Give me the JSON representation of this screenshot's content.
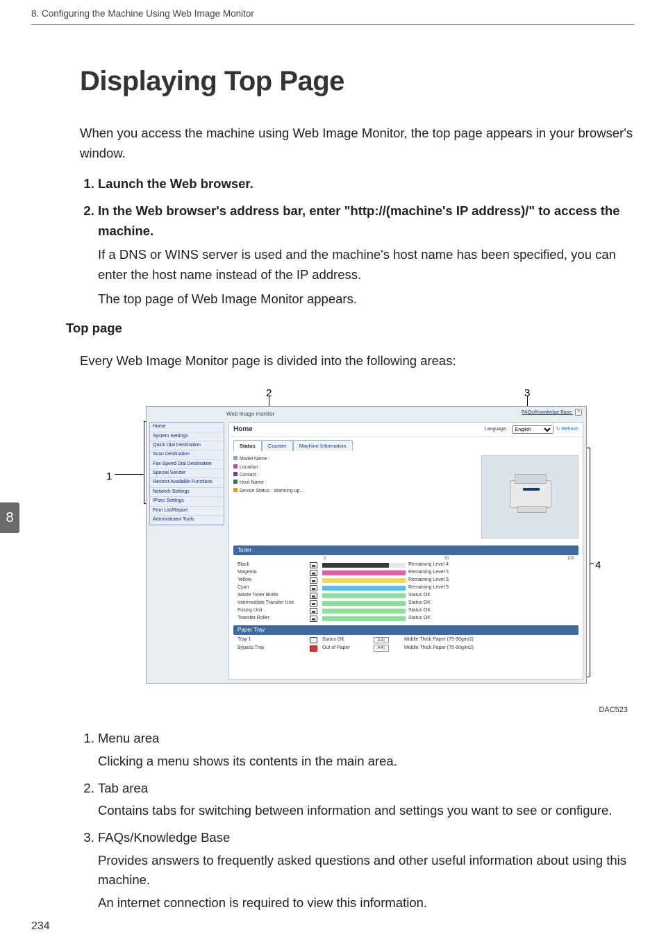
{
  "running_head": "8. Configuring the Machine Using Web Image Monitor",
  "chapter_tab": "8",
  "page_number": "234",
  "title": "Displaying Top Page",
  "intro": "When you access the machine using Web Image Monitor, the top page appears in your browser's window.",
  "steps": [
    {
      "head": "Launch the Web browser.",
      "body": []
    },
    {
      "head": "In the Web browser's address bar, enter \"http://(machine's IP address)/\" to access the machine.",
      "body": [
        "If a DNS or WINS server is used and the machine's host name has been specified, you can enter the host name instead of the IP address.",
        "The top page of Web Image Monitor appears."
      ]
    }
  ],
  "subhead_top_page": "Top page",
  "top_page_intro": "Every Web Image Monitor page is divided into the following areas:",
  "callouts": {
    "c1": "1",
    "c2": "2",
    "c3": "3",
    "c4": "4"
  },
  "figure_id": "DAC523",
  "screenshot": {
    "brand": "Web image monitor",
    "faq_link": "FAQs/Knowledge Base",
    "faq_icon": "?",
    "sidebar": [
      "Home",
      "System Settings",
      "Quick Dial Destination",
      "Scan Destination",
      "Fax Speed Dial Destination",
      "Special Sender",
      "Restrict Available Functions",
      "Network Settings",
      "IPsec Settings",
      "Print List/Report",
      "Administrator Tools"
    ],
    "main": {
      "title": "Home",
      "language_label": "Language :",
      "language_value": "English",
      "refresh": "Refresh",
      "tabs": [
        "Status",
        "Counter",
        "Machine Information"
      ],
      "status_rows": [
        {
          "cls": "model",
          "label": "Model Name",
          "value": ":"
        },
        {
          "cls": "loc",
          "label": "Location",
          "value": ":"
        },
        {
          "cls": "cont",
          "label": "Contact",
          "value": ":"
        },
        {
          "cls": "host",
          "label": "Host Name",
          "value": ":"
        },
        {
          "cls": "dev",
          "label": "Device Status",
          "value": ": Warming up..."
        }
      ],
      "toner_header": "Toner",
      "toner_scale": [
        "0",
        "50",
        "100"
      ],
      "toner": [
        {
          "name": "Black",
          "level": 80,
          "color": "#3a3a3a",
          "status": "Remaining Level 4"
        },
        {
          "name": "Magenta",
          "level": 100,
          "color": "#e85aa6",
          "status": "Remaining Level 5"
        },
        {
          "name": "Yellow",
          "level": 100,
          "color": "#f4d94a",
          "status": "Remaining Level 5"
        },
        {
          "name": "Cyan",
          "level": 100,
          "color": "#58c3e6",
          "status": "Remaining Level 5"
        },
        {
          "name": "Waste Toner Bottle",
          "level": 100,
          "color": "#8de09a",
          "status": "Status OK"
        },
        {
          "name": "Intermediate Transfer Unit",
          "level": 100,
          "color": "#8de09a",
          "status": "Status OK"
        },
        {
          "name": "Fusing Unit",
          "level": 100,
          "color": "#8de09a",
          "status": "Status OK"
        },
        {
          "name": "Transfer Roller",
          "level": 100,
          "color": "#8de09a",
          "status": "Status OK"
        }
      ],
      "tray_header": "Paper Tray",
      "trays": [
        {
          "name": "Tray 1",
          "state": "ok",
          "status": "Status OK",
          "size": "A4",
          "media": "Middle Thick Paper (75-90g/m2)"
        },
        {
          "name": "Bypass Tray",
          "state": "out",
          "status": "Out of Paper",
          "size": "A4",
          "media": "Middle Thick Paper (75-90g/m2)"
        }
      ]
    }
  },
  "legend": [
    {
      "head": "Menu area",
      "body": [
        "Clicking a menu shows its contents in the main area."
      ]
    },
    {
      "head": "Tab area",
      "body": [
        "Contains tabs for switching between information and settings you want to see or configure."
      ]
    },
    {
      "head": "FAQs/Knowledge Base",
      "body": [
        "Provides answers to frequently asked questions and other useful information about using this machine.",
        "An internet connection is required to view this information."
      ]
    }
  ]
}
